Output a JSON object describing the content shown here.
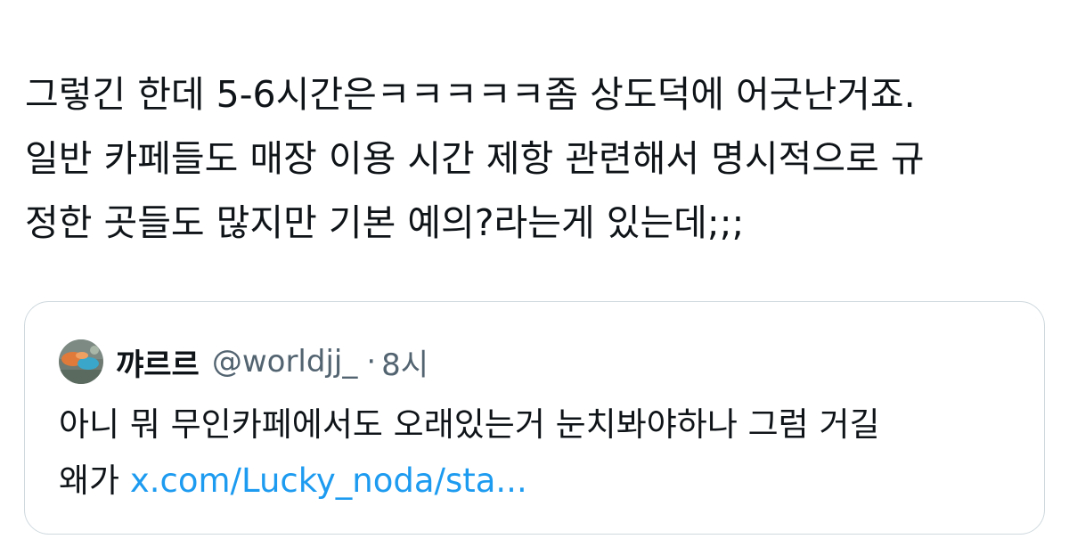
{
  "tweet": {
    "lines": [
      "그렇긴 한데 5-6시간은ㅋㅋㅋㅋㅋ좀 상도덕에 어긋난거죠.",
      "일반 카페들도 매장 이용 시간 제항 관련해서 명시적으로 규",
      "정한 곳들도 많지만 기본 예의?라는게 있는데;;;"
    ]
  },
  "quote": {
    "display_name": "꺄르르",
    "handle": "@worldjj_",
    "separator": "·",
    "time": "8시",
    "body_line1": "아니 뭐 무인카페에서도 오래있는거 눈치봐야하나 그럼 거길",
    "body_line2_prefix": "왜가 ",
    "link_text": "x.com/Lucky_noda/sta..."
  },
  "colors": {
    "text": "#0f1419",
    "secondary": "#536471",
    "link": "#1d9bf0",
    "border": "#cfd9de"
  },
  "icons": {
    "avatar": "profile-photo"
  }
}
